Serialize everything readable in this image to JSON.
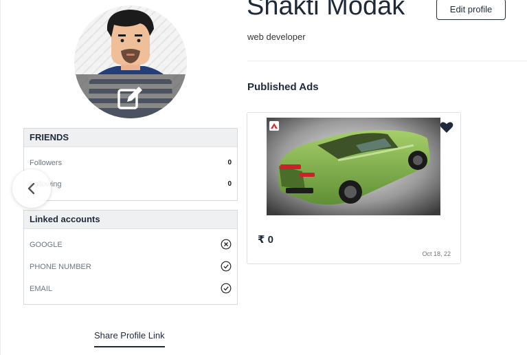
{
  "profile": {
    "name": "Shakti Modak",
    "role": "web developer",
    "edit_profile_label": "Edit profile"
  },
  "friends": {
    "header": "FRIENDS",
    "rows": [
      {
        "label": "Followers",
        "value": "0"
      },
      {
        "label": "Following",
        "value": "0"
      }
    ]
  },
  "linked_accounts": {
    "header": "Linked accounts",
    "rows": [
      {
        "label": "GOOGLE",
        "status": "not-linked",
        "icon": "x-circle-icon"
      },
      {
        "label": "PHONE NUMBER",
        "status": "linked",
        "icon": "check-circle-icon"
      },
      {
        "label": "EMAIL",
        "status": "linked",
        "icon": "check-circle-icon"
      }
    ]
  },
  "share_profile_label": "Share Profile Link",
  "published_ads": {
    "title": "Published Ads",
    "items": [
      {
        "price": "₹ 0",
        "date": "Oct 18, 22",
        "image": "green car"
      }
    ]
  },
  "colors": {
    "primary": "#1e2a3a",
    "muted": "#6c757d",
    "card_header_bg": "#eef0f2",
    "border": "#d6d9dc"
  }
}
